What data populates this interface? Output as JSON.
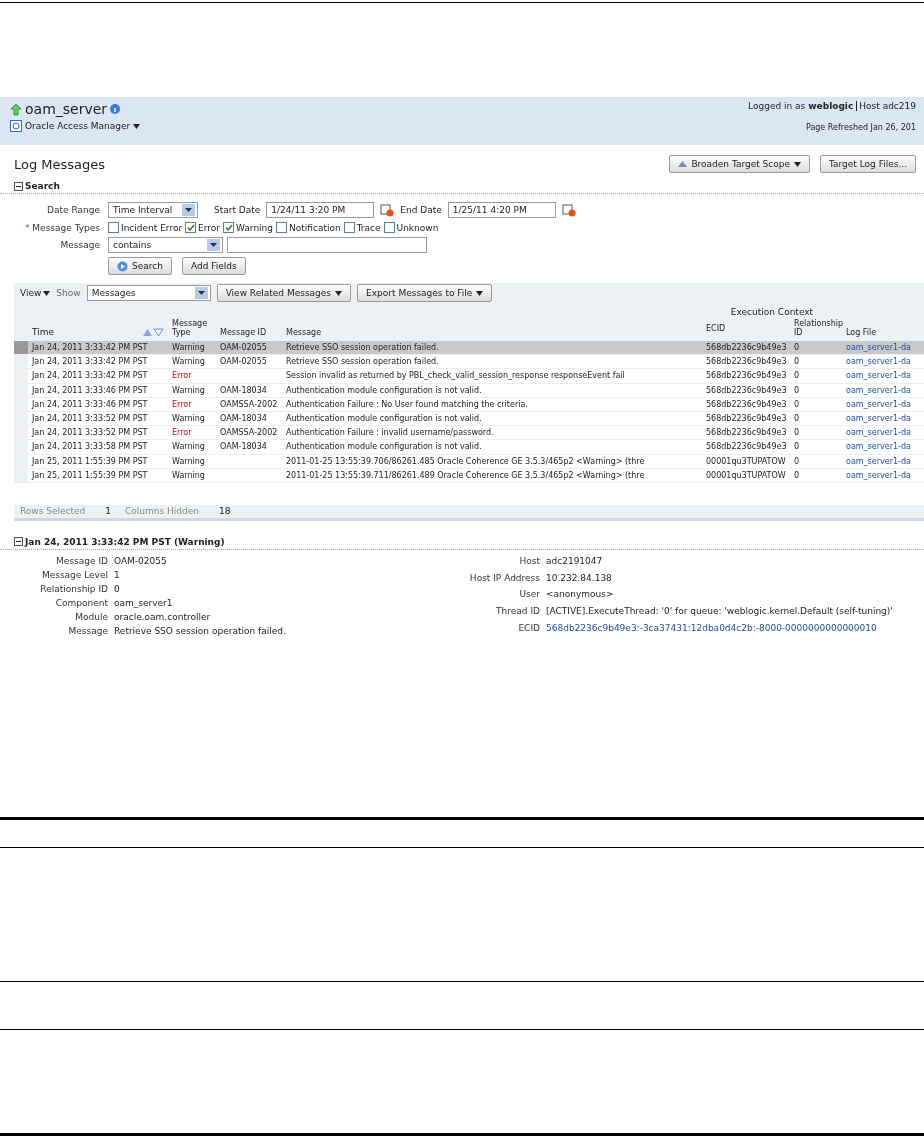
{
  "header": {
    "target": "oam_server",
    "target_type": "Oracle Access Manager",
    "login_label": "Logged in as",
    "user": "weblogic",
    "host": "Host adc219",
    "refreshed": "Page Refreshed Jan 26, 201"
  },
  "page_title": "Log Messages",
  "actions": [
    "Broaden Target Scope",
    "Target Log Files..."
  ],
  "search": {
    "title": "Search",
    "expanded": true,
    "date_range": {
      "label": "Date Range",
      "value": "Time Interval",
      "start_label": "Start Date",
      "start": "1/24/11 3:20 PM",
      "end_label": "End Date",
      "end": "1/25/11 4:20 PM"
    },
    "types_label": "Message Types",
    "required_mark": "*",
    "types": [
      {
        "label": "Incident Error",
        "checked": false
      },
      {
        "label": "Error",
        "checked": true
      },
      {
        "label": "Warning",
        "checked": true
      },
      {
        "label": "Notification",
        "checked": false
      },
      {
        "label": "Trace",
        "checked": false
      },
      {
        "label": "Unknown",
        "checked": false
      }
    ],
    "message": {
      "label": "Message",
      "operator": "contains"
    },
    "buttons": [
      "Search",
      "Add Fields"
    ]
  },
  "toolbar": {
    "view": "View",
    "show_label": "Show",
    "show": "Messages",
    "buttons": [
      "View Related Messages",
      "Export Messages to File"
    ]
  },
  "table": {
    "columns": [
      "Time",
      "Message Type",
      "Message ID",
      "Message",
      "ECID",
      "Relationship ID",
      "Log File"
    ],
    "group": "Execution Context",
    "rows": [
      {
        "selected": true,
        "kind": "warning",
        "time": "Jan 24, 2011 3:33:42 PM PST",
        "type": "Warning",
        "id": "OAM-02055",
        "message": "Retrieve SSO session operation failed.",
        "ecid": "568db2236c9b49e3",
        "rel": "0",
        "file": "oam_server1-da"
      },
      {
        "selected": false,
        "kind": "warning",
        "time": "Jan 24, 2011 3:33:42 PM PST",
        "type": "Warning",
        "id": "OAM-02055",
        "message": "Retrieve SSO session operation failed.",
        "ecid": "568db2236c9b49e3",
        "rel": "0",
        "file": "oam_server1-da"
      },
      {
        "selected": false,
        "kind": "error",
        "time": "Jan 24, 2011 3:33:42 PM PST",
        "type": "Error",
        "id": "",
        "message": "Session invalid as returned by PBL_check_valid_session_response responseEvent fail",
        "ecid": "568db2236c9b49e3",
        "rel": "0",
        "file": "oam_server1-da"
      },
      {
        "selected": false,
        "kind": "warning",
        "time": "Jan 24, 2011 3:33:46 PM PST",
        "type": "Warning",
        "id": "OAM-18034",
        "message": "Authentication module configuration is not valid.",
        "ecid": "568db2236c9b49e3",
        "rel": "0",
        "file": "oam_server1-da"
      },
      {
        "selected": false,
        "kind": "error",
        "time": "Jan 24, 2011 3:33:46 PM PST",
        "type": "Error",
        "id": "OAMSSA-2002",
        "message": "Authentication Failure : No User found matching the criteria.",
        "ecid": "568db2236c9b49e3",
        "rel": "0",
        "file": "oam_server1-da"
      },
      {
        "selected": false,
        "kind": "warning",
        "time": "Jan 24, 2011 3:33:52 PM PST",
        "type": "Warning",
        "id": "OAM-18034",
        "message": "Authentication module configuration is not valid.",
        "ecid": "568db2236c9b49e3",
        "rel": "0",
        "file": "oam_server1-da"
      },
      {
        "selected": false,
        "kind": "error",
        "time": "Jan 24, 2011 3:33:52 PM PST",
        "type": "Error",
        "id": "OAMSSA-2002",
        "message": "Authentication Failure : invalid username/password.",
        "ecid": "568db2236c9b49e3",
        "rel": "0",
        "file": "oam_server1-da"
      },
      {
        "selected": false,
        "kind": "warning",
        "time": "Jan 24, 2011 3:33:58 PM PST",
        "type": "Warning",
        "id": "OAM-18034",
        "message": "Authentication module configuration is not valid.",
        "ecid": "568db2236c9b49e3",
        "rel": "0",
        "file": "oam_server1-da"
      },
      {
        "selected": false,
        "kind": "warning",
        "time": "Jan 25, 2011 1:55:39 PM PST",
        "type": "Warning",
        "id": "",
        "message": "2011-01-25 13:55:39.706/86261.485 Oracle Coherence GE 3.5.3/465p2 <Warning> (thre",
        "ecid": "00001qu3TUPATOW",
        "rel": "0",
        "file": "oam_server1-da"
      },
      {
        "selected": false,
        "kind": "warning",
        "time": "Jan 25, 2011 1:55:39 PM PST",
        "type": "Warning",
        "id": "",
        "message": "2011-01-25 13:55:39.711/86261.489 Oracle Coherence GE 3.5.3/465p2 <Warning> (thre",
        "ecid": "00001qu3TUPATOW",
        "rel": "0",
        "file": "oam_server1-da"
      }
    ]
  },
  "status": [
    {
      "label": "Rows Selected",
      "value": "1"
    },
    {
      "label": "Columns Hidden",
      "value": "18"
    }
  ],
  "detail": {
    "title": "Jan 24, 2011 3:33:42 PM PST (Warning)",
    "expanded": true,
    "left": [
      {
        "label": "Message ID",
        "value": "OAM-02055",
        "link": false
      },
      {
        "label": "Message Level",
        "value": "1",
        "link": false
      },
      {
        "label": "Relationship ID",
        "value": "0",
        "link": false
      },
      {
        "label": "Component",
        "value": "oam_server1",
        "link": false
      },
      {
        "label": "Module",
        "value": "oracle.oam.controller",
        "link": false
      },
      {
        "label": "Message",
        "value": "Retrieve SSO session operation failed.",
        "link": false
      }
    ],
    "right": [
      {
        "label": "Host",
        "value": "adc2191047",
        "link": false
      },
      {
        "label": "Host IP Address",
        "value": "10.232.84.138",
        "link": false
      },
      {
        "label": "User",
        "value": "<anonymous>",
        "link": false
      },
      {
        "label": "Thread ID",
        "value": "[ACTIVE].ExecuteThread: '0' for queue: 'weblogic.kernel.Default (self-tuning)'",
        "link": false
      },
      {
        "label": "ECID",
        "value": "568db2236c9b49e3:-3ca37431:12dba0d4c2b:-8000-0000000000000010",
        "link": true
      }
    ]
  }
}
